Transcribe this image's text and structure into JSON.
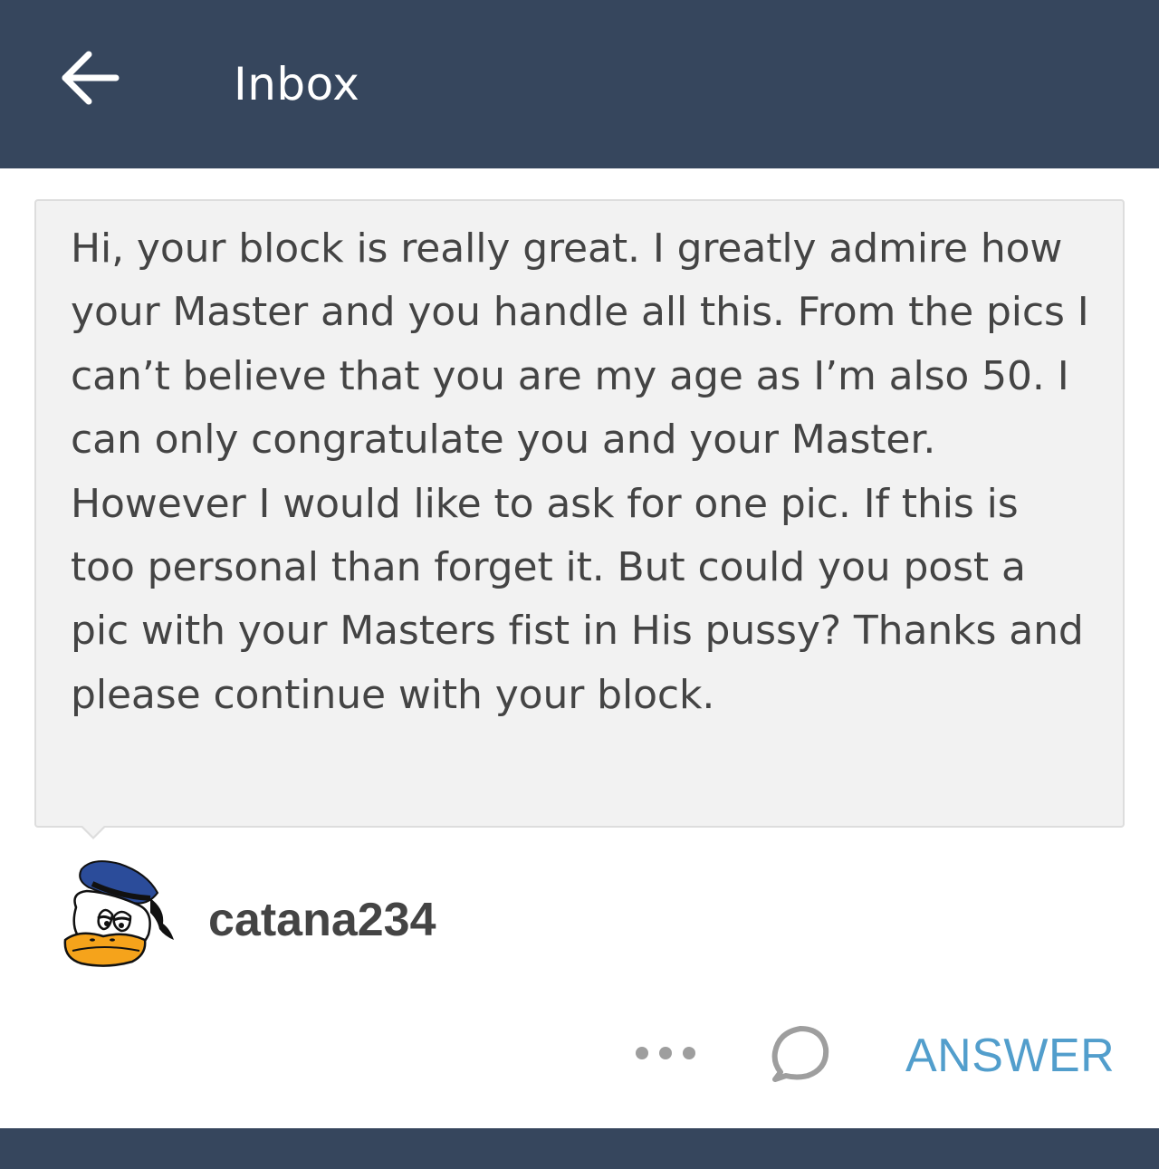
{
  "header": {
    "back_icon": "arrow-left-icon",
    "title": "Inbox"
  },
  "message": {
    "text": "Hi, your block is really great. I greatly admire how your Master and you handle all this. From the pics I can’t believe that you are my age as I’m also 50. I can only congratulate you and your Master. However I would like to ask for one pic. If this is too personal than forget it. But could you post a pic with your Masters fist in His pussy? Thanks and please continue with your block.",
    "sender": {
      "username": "catana234",
      "avatar_icon": "donald-duck-avatar"
    }
  },
  "actions": {
    "more_icon": "more-dots-icon",
    "reply_icon": "speech-bubble-icon",
    "answer_label": "ANSWER"
  },
  "colors": {
    "header_bg": "#36465d",
    "bubble_bg": "#f2f2f2",
    "accent": "#529ecc",
    "text": "#444444"
  }
}
